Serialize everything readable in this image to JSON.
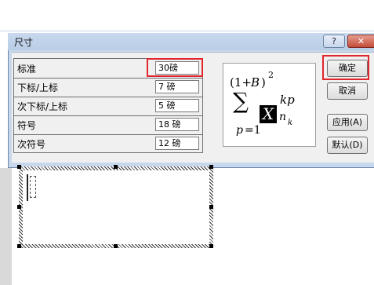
{
  "dialog": {
    "title": "尺寸",
    "help_glyph": "?",
    "close_glyph": "✕"
  },
  "rows": [
    {
      "label": "标准",
      "value": "30磅"
    },
    {
      "label": "下标/上标",
      "value": "7 磅"
    },
    {
      "label": "次下标/上标",
      "value": "5 磅"
    },
    {
      "label": "符号",
      "value": "18 磅"
    },
    {
      "label": "次符号",
      "value": "12 磅"
    }
  ],
  "buttons": {
    "ok": "确定",
    "cancel": "取消",
    "apply": "应用(A)",
    "default": "默认(D)"
  },
  "preview": {
    "open": "(1+",
    "B": "B",
    "close": ")",
    "exp2": "2",
    "sigma": "∑",
    "X": "X",
    "kp": "kp",
    "n": "n",
    "k": "k",
    "p": "p",
    "eq1": "=1"
  },
  "colors": {
    "highlight": "#e0262c",
    "dialog_frame": "#c8d8ec"
  }
}
